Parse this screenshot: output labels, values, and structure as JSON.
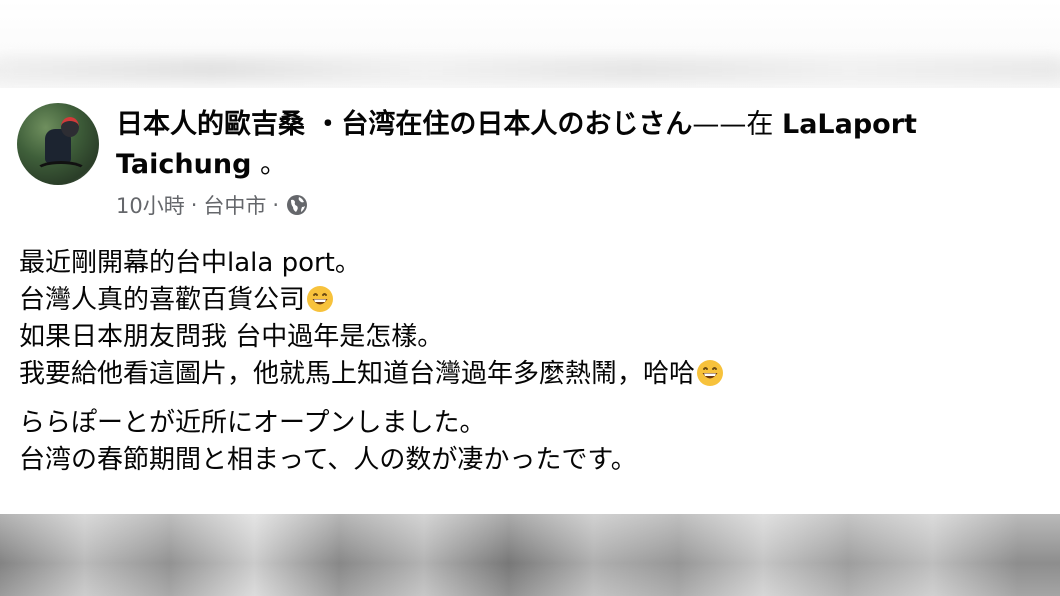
{
  "post": {
    "author_name": "日本人的歐吉桑 ・台湾在住の日本人のおじさん",
    "location_connector": "——在 ",
    "location_name": "LaLaport Taichung",
    "location_suffix": " 。",
    "meta": {
      "time": "10小時",
      "separator1": " · ",
      "place": "台中市",
      "separator2": " · ",
      "privacy_icon": "globe-icon"
    },
    "lines": {
      "l1": "最近剛開幕的台中lala port。",
      "l2": "台灣人真的喜歡百貨公司",
      "l3": "如果日本朋友問我 台中過年是怎樣。",
      "l4": "我要給他看這圖片，他就馬上知道台灣過年多麼熱鬧，哈哈",
      "l5": "ららぽーとが近所にオープンしました。",
      "l6": "台湾の春節期間と相まって、人の数が凄かったです。"
    },
    "emoji_icon": "grinning-face-emoji"
  }
}
